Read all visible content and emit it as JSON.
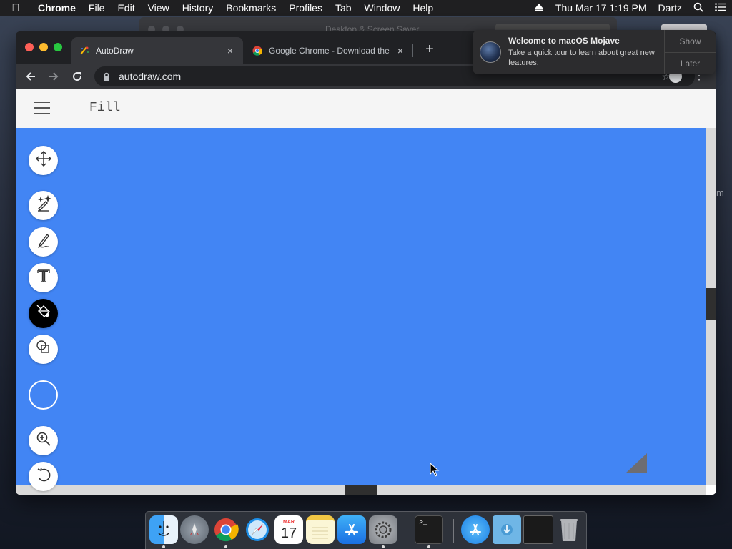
{
  "menubar": {
    "app_name": "Chrome",
    "items": [
      "File",
      "Edit",
      "View",
      "History",
      "Bookmarks",
      "Profiles",
      "Tab",
      "Window",
      "Help"
    ],
    "datetime": "Thu Mar 17  1:19 PM",
    "user": "Dartz"
  },
  "background": {
    "ghost_title": "Desktop & Screen Saver",
    "side_text": "m"
  },
  "browser": {
    "tabs": [
      {
        "title": "AutoDraw",
        "favicon": "autodraw-icon",
        "active": true
      },
      {
        "title": "Google Chrome - Download the",
        "favicon": "chrome-icon",
        "active": false
      }
    ],
    "url": "autodraw.com",
    "new_tab_glyph": "+",
    "close_tab_glyph": "×"
  },
  "autodraw": {
    "mode_title": "Fill",
    "canvas_color": "#4285f4",
    "tools": [
      {
        "name": "move-tool",
        "icon": "move-arrows-icon",
        "active": false
      },
      {
        "name": "autodraw-tool",
        "icon": "magic-pencil-icon",
        "active": false
      },
      {
        "name": "draw-tool",
        "icon": "pencil-icon",
        "active": false
      },
      {
        "name": "type-tool",
        "icon": "text-t-icon",
        "active": false
      },
      {
        "name": "fill-tool",
        "icon": "paint-bucket-icon",
        "active": true
      },
      {
        "name": "shape-tool",
        "icon": "shapes-icon",
        "active": false
      },
      {
        "name": "color-picker",
        "icon": "color-circle-icon",
        "active": false
      },
      {
        "name": "zoom-tool",
        "icon": "zoom-icon",
        "active": false
      },
      {
        "name": "undo-button",
        "icon": "undo-icon",
        "active": false
      }
    ]
  },
  "notification": {
    "title": "Welcome to macOS Mojave",
    "body": "Take a quick tour to learn about great new features.",
    "show_label": "Show",
    "later_label": "Later"
  },
  "dock": {
    "apps": [
      "Finder",
      "Launchpad",
      "Chrome",
      "Safari",
      "Calendar",
      "Notes",
      "App Store",
      "System Preferences",
      "Terminal",
      "Applications",
      "Downloads",
      "Screenshot",
      "Trash"
    ],
    "calendar_month": "MAR",
    "calendar_day": "17",
    "terminal_prompt": ">_"
  }
}
